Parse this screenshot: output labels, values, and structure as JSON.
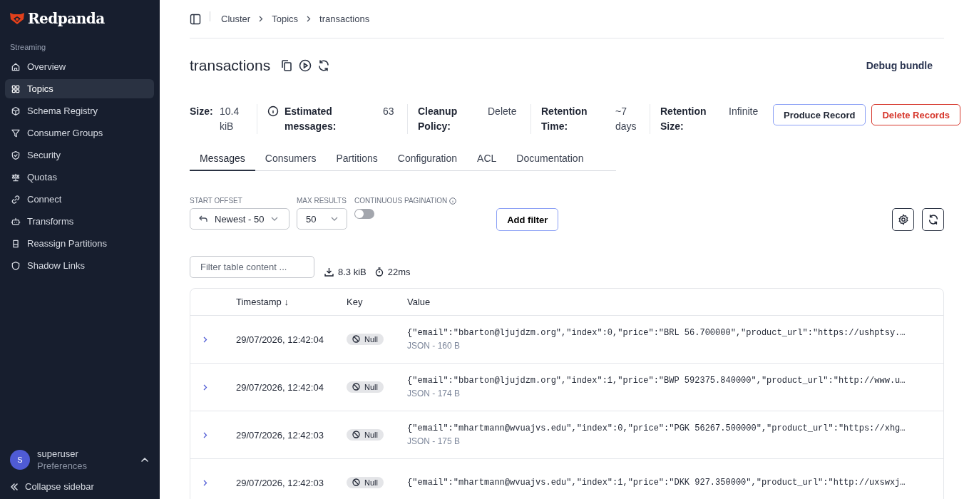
{
  "sidebar": {
    "brand": "Redpanda",
    "section": "Streaming",
    "items": [
      {
        "label": "Overview",
        "selected": false
      },
      {
        "label": "Topics",
        "selected": true
      },
      {
        "label": "Schema Registry",
        "selected": false
      },
      {
        "label": "Consumer Groups",
        "selected": false
      },
      {
        "label": "Security",
        "selected": false
      },
      {
        "label": "Quotas",
        "selected": false
      },
      {
        "label": "Connect",
        "selected": false
      },
      {
        "label": "Transforms",
        "selected": false
      },
      {
        "label": "Reassign Partitions",
        "selected": false
      },
      {
        "label": "Shadow Links",
        "selected": false
      }
    ],
    "user": {
      "initial": "S",
      "name": "superuser",
      "subtitle": "Preferences"
    },
    "collapse": "Collapse sidebar"
  },
  "breadcrumb": [
    "Cluster",
    "Topics",
    "transactions"
  ],
  "topic": {
    "title": "transactions",
    "debug": "Debug bundle"
  },
  "stats": [
    {
      "label": "Size:",
      "value": "10.4 kiB"
    },
    {
      "label": "Estimated messages:",
      "value": "63"
    },
    {
      "label": "Cleanup Policy:",
      "value": "Delete"
    },
    {
      "label": "Retention Time:",
      "value": "~7 days"
    },
    {
      "label": "Retention Size:",
      "value": "Infinite"
    }
  ],
  "actions": [
    {
      "label": "Produce Record",
      "kind": "primary"
    },
    {
      "label": "Delete Records",
      "kind": "danger"
    }
  ],
  "tabs": [
    {
      "label": "Messages",
      "selected": true
    },
    {
      "label": "Consumers",
      "selected": false
    },
    {
      "label": "Partitions",
      "selected": false
    },
    {
      "label": "Configuration",
      "selected": false
    },
    {
      "label": "ACL",
      "selected": false
    },
    {
      "label": "Documentation",
      "selected": false
    }
  ],
  "controls": {
    "start_offset": {
      "label": "START OFFSET",
      "value": "Newest - 50"
    },
    "max_results": {
      "label": "MAX RESULTS",
      "value": "50"
    },
    "continuous": {
      "label": "CONTINUOUS PAGINATION",
      "on": false
    },
    "add_filter": "Add filter"
  },
  "filter": {
    "placeholder": "Filter table content ...",
    "size": "8.3 kiB",
    "time": "22ms"
  },
  "table": {
    "columns": [
      "Timestamp ↓",
      "Key",
      "Value"
    ],
    "rows": [
      {
        "timestamp": "29/07/2026, 12:42:04",
        "key": "Null",
        "value": "{\"email\":\"bbarton@ljujdzm.org\",\"index\":0,\"price\":\"BRL 56.700000\",\"product_url\":\"https://ushptsy.…",
        "meta": "JSON - 160 B"
      },
      {
        "timestamp": "29/07/2026, 12:42:04",
        "key": "Null",
        "value": "{\"email\":\"bbarton@ljujdzm.org\",\"index\":1,\"price\":\"BWP 592375.840000\",\"product_url\":\"http://www.u…",
        "meta": "JSON - 174 B"
      },
      {
        "timestamp": "29/07/2026, 12:42:03",
        "key": "Null",
        "value": "{\"email\":\"mhartmann@wvuajvs.edu\",\"index\":0,\"price\":\"PGK 56267.500000\",\"product_url\":\"https://xhg…",
        "meta": "JSON - 175 B"
      },
      {
        "timestamp": "29/07/2026, 12:42:03",
        "key": "Null",
        "value": "{\"email\":\"mhartmann@wvuajvs.edu\",\"index\":1,\"price\":\"DKK 927.350000\",\"product_url\":\"http://uxswxj…"
      }
    ]
  }
}
